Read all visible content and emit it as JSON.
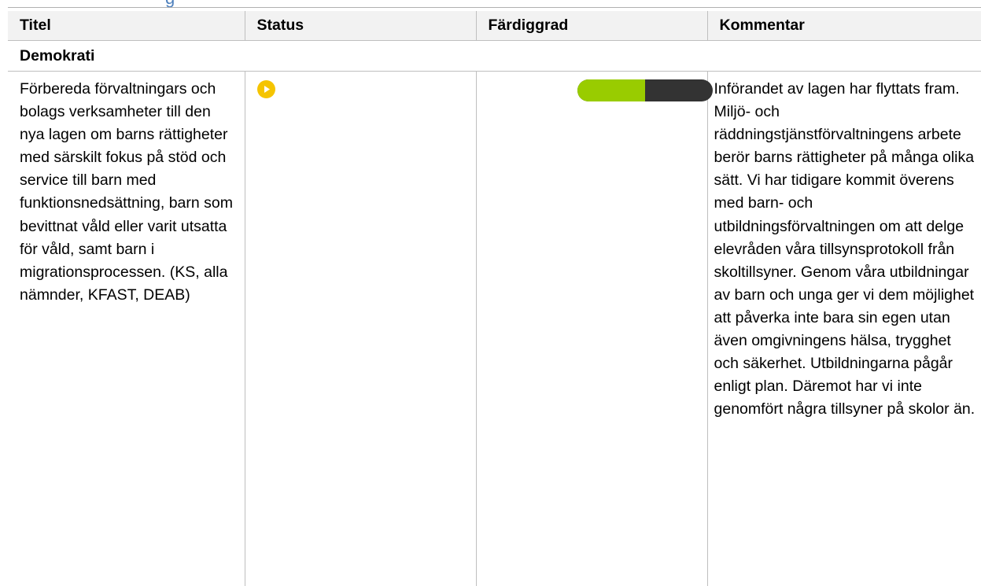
{
  "heading_fragment": "g",
  "table": {
    "headers": [
      "Titel",
      "Status",
      "Färdiggrad",
      "Kommentar"
    ],
    "section": "Demokrati",
    "row": {
      "title": "Förbereda förvaltningars och bolags verksamheter till den nya lagen om barns rättigheter med särskilt fokus på stöd och service till barn med funktionsnedsättning, barn som bevittnat våld eller varit utsatta för våld, samt barn i migrationsprocessen. (KS, alla nämnder, KFAST, DEAB)",
      "status_icon": "play-circle-icon",
      "status_color": "#f5c400",
      "progress_fraction": 0.5,
      "progress_fill_color": "#99cc00",
      "progress_track_color": "#333333",
      "comment": "Införandet av lagen har flyttats fram. Miljö- och räddningstjänstförvaltningens arbete berör barns rättigheter på många olika sätt. Vi har tidigare kommit överens med barn- och utbildningsförvaltningen om att delge elevråden våra tillsynsprotokoll från skoltillsyner. Genom våra utbildningar av barn och unga ger vi dem möjlighet att påverka inte bara sin egen utan även omgivningens hälsa, trygghet och säkerhet. Utbildningarna pågår enligt plan. Däremot har vi inte genomfört några tillsyner på skolor än."
    }
  },
  "colors": {
    "header_bg": "#f2f2f2",
    "border": "#bfbfbf",
    "heading_blue": "#4f81bd"
  }
}
